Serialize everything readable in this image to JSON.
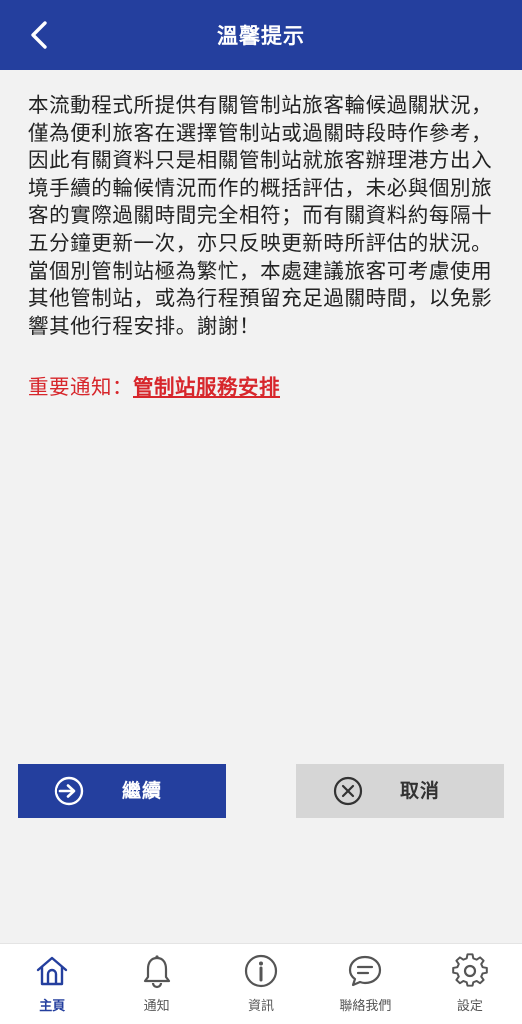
{
  "header": {
    "title": "溫馨提示"
  },
  "content": {
    "notice": "本流動程式所提供有關管制站旅客輪候過關狀況，僅為便利旅客在選擇管制站或過關時段時作參考，因此有關資料只是相關管制站就旅客辦理港方出入境手續的輪候情況而作的概括評估，未必與個別旅客的實際過關時間完全相符；而有關資料約每隔十五分鐘更新一次，亦只反映更新時所評估的狀況。當個別管制站極為繁忙，本處建議旅客可考慮使用其他管制站，或為行程預留充足過關時間，以免影響其他行程安排。謝謝！",
    "important_label": "重要通知：",
    "important_link": "管制站服務安排"
  },
  "buttons": {
    "continue_label": "繼續",
    "cancel_label": "取消"
  },
  "tabbar": {
    "items": [
      {
        "label": "主頁",
        "icon": "home-icon",
        "active": true
      },
      {
        "label": "通知",
        "icon": "bell-icon",
        "active": false
      },
      {
        "label": "資訊",
        "icon": "info-icon",
        "active": false
      },
      {
        "label": "聯絡我們",
        "icon": "chat-icon",
        "active": false
      },
      {
        "label": "設定",
        "icon": "gear-icon",
        "active": false
      }
    ]
  },
  "colors": {
    "primary": "#243f9e",
    "alert": "#d7262b",
    "cancel_bg": "#d6d6d6",
    "background": "#f2f2f2"
  }
}
